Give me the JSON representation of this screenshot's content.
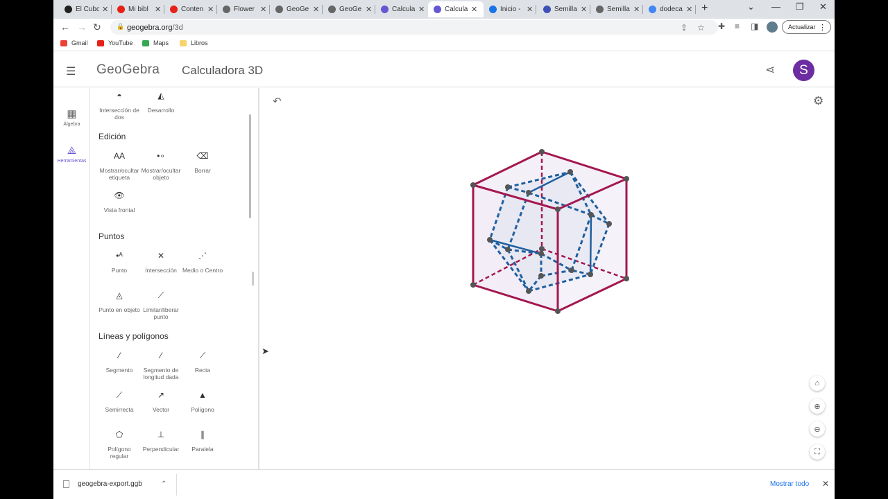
{
  "browser": {
    "tabs": [
      {
        "label": "El Cubo",
        "color": "#222"
      },
      {
        "label": "Mi bibl",
        "color": "#e62117"
      },
      {
        "label": "Conten",
        "color": "#e62117"
      },
      {
        "label": "Flower",
        "color": "#666"
      },
      {
        "label": "GeoGe",
        "color": "#666"
      },
      {
        "label": "GeoGe",
        "color": "#666"
      },
      {
        "label": "Calcula",
        "color": "#6557d2"
      },
      {
        "label": "Calcula",
        "color": "#6557d2"
      },
      {
        "label": "Inicio -",
        "color": "#1a73e8"
      },
      {
        "label": "Semilla",
        "color": "#3f51b5"
      },
      {
        "label": "Semilla",
        "color": "#666"
      },
      {
        "label": "dodeca",
        "color": "#4285f4"
      }
    ],
    "url_host": "geogebra.org",
    "url_path": "/3d",
    "update_label": "Actualizar",
    "bookmarks": [
      {
        "label": "Gmail",
        "color": "#ea4335"
      },
      {
        "label": "YouTube",
        "color": "#e62117"
      },
      {
        "label": "Maps",
        "color": "#34a853"
      },
      {
        "label": "Libros",
        "color": "#f6d36b"
      }
    ]
  },
  "app": {
    "logo": "GeoGebra",
    "title": "Calculadora 3D",
    "avatar_letter": "S",
    "avatar_color": "#6b2da1",
    "accent": "#6557d2"
  },
  "rail": {
    "algebra": "Álgebra",
    "tools": "Herramientas"
  },
  "tools": {
    "top": [
      {
        "label": "Intersección de dos",
        "icon": "intersect-surfaces-icon"
      },
      {
        "label": "Desarrollo",
        "icon": "net-icon"
      }
    ],
    "sections": [
      {
        "title": "Edición",
        "items": [
          {
            "label": "Mostrar/ocultar etiqueta",
            "icon": "show-hide-label-icon"
          },
          {
            "label": "Mostrar/ocultar objeto",
            "icon": "show-hide-object-icon"
          },
          {
            "label": "Borrar",
            "icon": "eraser-icon"
          },
          {
            "label": "Vista frontal",
            "icon": "front-view-icon"
          }
        ]
      },
      {
        "title": "Puntos",
        "items": [
          {
            "label": "Punto",
            "icon": "point-icon"
          },
          {
            "label": "Intersección",
            "icon": "intersect-icon"
          },
          {
            "label": "Medio o Centro",
            "icon": "midpoint-icon"
          },
          {
            "label": "Punto en objeto",
            "icon": "point-on-object-icon"
          },
          {
            "label": "Limitar/liberar punto",
            "icon": "attach-detach-icon"
          }
        ]
      },
      {
        "title": "Líneas y polígonos",
        "items": [
          {
            "label": "Segmento",
            "icon": "segment-icon"
          },
          {
            "label": "Segmento de longitud dada",
            "icon": "segment-fixed-icon"
          },
          {
            "label": "Recta",
            "icon": "line-icon"
          },
          {
            "label": "Semirrecta",
            "icon": "ray-icon"
          },
          {
            "label": "Vector",
            "icon": "vector-icon"
          },
          {
            "label": "Polígono",
            "icon": "polygon-icon"
          },
          {
            "label": "Polígono regular",
            "icon": "regular-polygon-icon"
          },
          {
            "label": "Perpendicular",
            "icon": "perpendicular-icon"
          },
          {
            "label": "Paralela",
            "icon": "parallel-icon"
          }
        ]
      }
    ]
  },
  "scene": {
    "cube_color": "#a4174f",
    "dodeca_color": "#1f5f9e",
    "face_fill": "#ece6f3"
  },
  "downloads": {
    "file": "geogebra-export.ggb",
    "show_all": "Mostrar todo"
  }
}
